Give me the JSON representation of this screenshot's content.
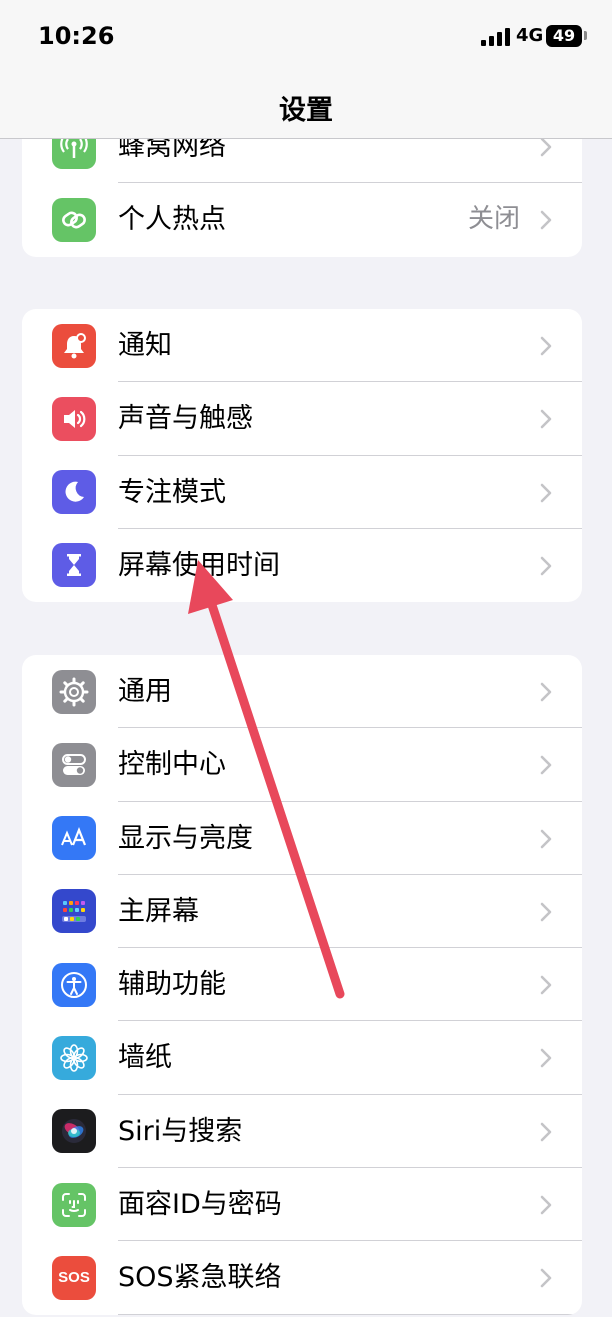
{
  "status_bar": {
    "time": "10:26",
    "network": "4G",
    "battery": "49"
  },
  "nav": {
    "title": "设置"
  },
  "groups": [
    {
      "items": [
        {
          "label": "蜂窝网络",
          "icon": "cellular-antenna-icon",
          "color": "#65c466"
        },
        {
          "label": "个人热点",
          "detail": "关闭",
          "icon": "hotspot-chain-icon",
          "color": "#65c466"
        }
      ]
    },
    {
      "items": [
        {
          "label": "通知",
          "icon": "bell-icon",
          "color": "#eb4d3d"
        },
        {
          "label": "声音与触感",
          "icon": "speaker-icon",
          "color": "#eb4e5f"
        },
        {
          "label": "专注模式",
          "icon": "moon-icon",
          "color": "#5e5ce6"
        },
        {
          "label": "屏幕使用时间",
          "icon": "hourglass-icon",
          "color": "#5e5ce6"
        }
      ]
    },
    {
      "items": [
        {
          "label": "通用",
          "icon": "gear-icon",
          "color": "#8e8e93"
        },
        {
          "label": "控制中心",
          "icon": "toggle-switches-icon",
          "color": "#8e8e93"
        },
        {
          "label": "显示与亮度",
          "icon": "text-size-icon",
          "color": "#3478f6"
        },
        {
          "label": "主屏幕",
          "icon": "home-grid-icon",
          "color": "#3448cc"
        },
        {
          "label": "辅助功能",
          "icon": "accessibility-icon",
          "color": "#3478f6"
        },
        {
          "label": "墙纸",
          "icon": "flower-icon",
          "color": "#36aadc"
        },
        {
          "label": "Siri与搜索",
          "icon": "siri-icon",
          "color": "#1c1c1e"
        },
        {
          "label": "面容ID与密码",
          "icon": "face-id-icon",
          "color": "#65c466"
        },
        {
          "label": "SOS紧急联络",
          "icon": "sos-icon",
          "color": "#eb4d3d",
          "icon_text": "SOS"
        }
      ]
    }
  ],
  "annotation": {
    "color": "#e8485b"
  }
}
